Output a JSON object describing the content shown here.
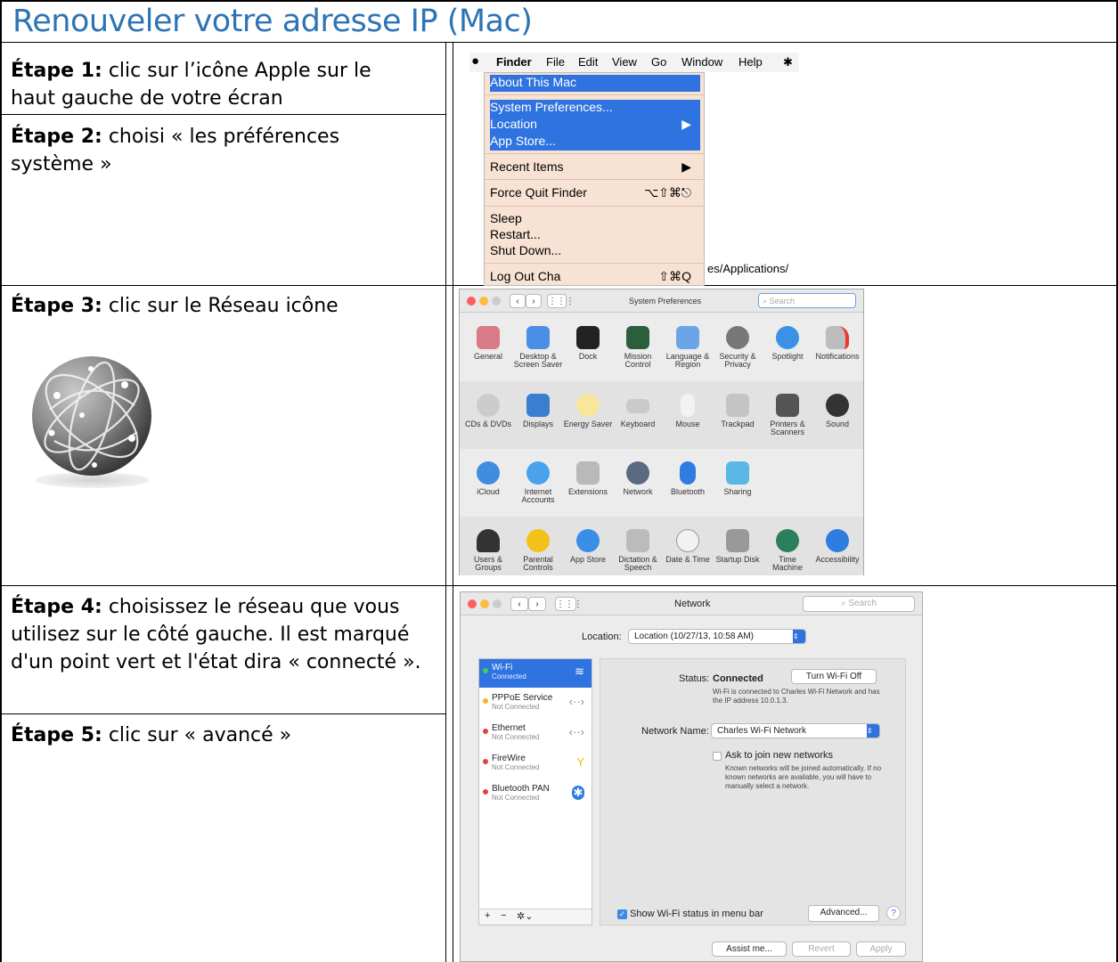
{
  "title": "Renouveler votre adresse IP (Mac)",
  "steps": {
    "s1_label": "Étape 1:",
    "s1_text": " clic sur l’icône Apple sur le haut gauche de votre écran",
    "s2_label": "Étape 2:",
    "s2_text": " choisi « les préférences système »",
    "s3_label": "Étape 3:",
    "s3_text": " clic sur le Réseau icône",
    "s4_label": "Étape 4:",
    "s4_text": " choisissez le réseau que vous utilisez sur le côté gauche. Il est marqué d'un point vert et l'état dira « connecté ».",
    "s5_label": "Étape 5:",
    "s5_text": " clic sur « avancé »"
  },
  "apple_menu": {
    "menubar": [
      "Finder",
      "File",
      "Edit",
      "View",
      "Go",
      "Window",
      "Help"
    ],
    "items": {
      "about": "About This Mac",
      "sysprefs": "System Preferences...",
      "location": "Location",
      "appstore": "App Store...",
      "recent": "Recent Items",
      "forcequit": "Force Quit Finder",
      "forcequit_sc": "⌥⇧⌘⎋",
      "sleep": "Sleep",
      "restart": "Restart...",
      "shutdown": "Shut Down...",
      "logout": "Log Out Cha",
      "logout_sc": "⇧⌘Q"
    },
    "path_fragment": "es/Applications/"
  },
  "sysprefs": {
    "window_title": "System Preferences",
    "search": "Search",
    "row1": [
      "General",
      "Desktop & Screen Saver",
      "Dock",
      "Mission Control",
      "Language & Region",
      "Security & Privacy",
      "Spotlight",
      "Notifications"
    ],
    "row2": [
      "CDs & DVDs",
      "Displays",
      "Energy Saver",
      "Keyboard",
      "Mouse",
      "Trackpad",
      "Printers & Scanners",
      "Sound"
    ],
    "row3": [
      "iCloud",
      "Internet Accounts",
      "Extensions",
      "Network",
      "Bluetooth",
      "Sharing"
    ],
    "row4": [
      "Users & Groups",
      "Parental Controls",
      "App Store",
      "Dictation & Speech",
      "Date & Time",
      "Startup Disk",
      "Time Machine",
      "Accessibility"
    ]
  },
  "network": {
    "window_title": "Network",
    "search": "Search",
    "location_label": "Location:",
    "location_value": "Location (10/27/13, 10:58 AM)",
    "services": [
      {
        "name": "Wi-Fi",
        "status": "Connected"
      },
      {
        "name": "PPPoE Service",
        "status": "Not Connected"
      },
      {
        "name": "Ethernet",
        "status": "Not Connected"
      },
      {
        "name": "FireWire",
        "status": "Not Connected"
      },
      {
        "name": "Bluetooth PAN",
        "status": "Not Connected"
      }
    ],
    "status_label": "Status:",
    "status_value": "Connected",
    "turn_off": "Turn Wi-Fi Off",
    "status_desc": "Wi-Fi is connected to Charles Wi-Fi Network and has the IP address 10.0.1.3.",
    "netname_label": "Network Name:",
    "netname_value": "Charles Wi-Fi Network",
    "ask_join": "Ask to join new networks",
    "ask_desc": "Known networks will be joined automatically. If no known networks are available, you will have to manually select a network.",
    "show_status": "Show Wi-Fi status in menu bar",
    "advanced": "Advanced...",
    "help": "?",
    "assist": "Assist me...",
    "revert": "Revert",
    "apply": "Apply",
    "list_controls": [
      "+",
      "−",
      "✲⌄"
    ]
  }
}
